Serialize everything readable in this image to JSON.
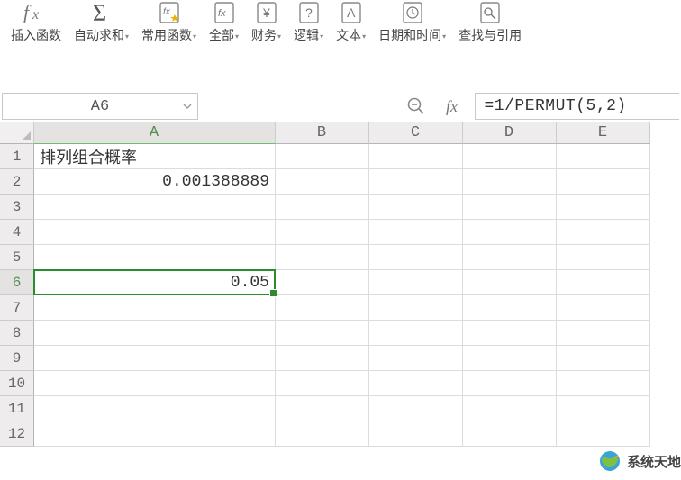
{
  "ribbon": {
    "items": [
      {
        "name": "insert-function",
        "label": "插入函数",
        "dropdown": false
      },
      {
        "name": "autosum",
        "label": "自动求和",
        "dropdown": true
      },
      {
        "name": "frequent",
        "label": "常用函数",
        "dropdown": true
      },
      {
        "name": "all",
        "label": "全部",
        "dropdown": true
      },
      {
        "name": "financial",
        "label": "财务",
        "dropdown": true
      },
      {
        "name": "logical",
        "label": "逻辑",
        "dropdown": true
      },
      {
        "name": "text",
        "label": "文本",
        "dropdown": true
      },
      {
        "name": "date-time",
        "label": "日期和时间",
        "dropdown": true
      },
      {
        "name": "lookup-ref",
        "label": "查找与引用",
        "dropdown": true,
        "clipped": true
      }
    ]
  },
  "formula_bar": {
    "cell_ref": "A6",
    "formula": "=1/PERMUT(5,2)"
  },
  "grid": {
    "columns": [
      "A",
      "B",
      "C",
      "D",
      "E"
    ],
    "active_col": "A",
    "rows": [
      1,
      2,
      3,
      4,
      5,
      6,
      7,
      8,
      9,
      10,
      11,
      12
    ],
    "active_row": 6,
    "cells": {
      "A1": "排列组合概率",
      "A2": "0.001388889",
      "A6": "0.05"
    },
    "right_aligned": [
      "A2",
      "A6"
    ],
    "selected_cell": "A6"
  },
  "watermark": {
    "text": "系统天地"
  }
}
